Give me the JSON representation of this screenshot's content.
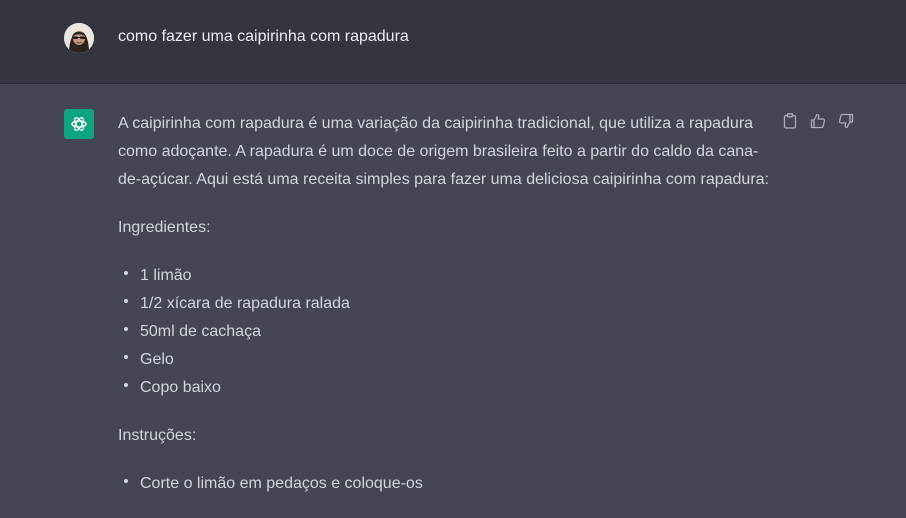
{
  "user_message": {
    "text": "como fazer uma caipirinha com rapadura",
    "avatar": "user-avatar-photo"
  },
  "assistant_message": {
    "intro": "A caipirinha com rapadura é uma variação da caipirinha tradicional, que utiliza a rapadura como adoçante. A rapadura é um doce de origem brasileira feito a partir do caldo da cana-de-açúcar. Aqui está uma receita simples para fazer uma deliciosa caipirinha com rapadura:",
    "ingredients_heading": "Ingredientes:",
    "ingredients": [
      "1 limão",
      "1/2 xícara de rapadura ralada",
      "50ml de cachaça",
      "Gelo",
      "Copo baixo"
    ],
    "instructions_heading": "Instruções:",
    "first_instruction_partial": "Corte o limão em pedaços e coloque-os"
  },
  "actions": {
    "copy": "clipboard-icon",
    "like": "thumbs-up-icon",
    "dislike": "thumbs-down-icon"
  },
  "colors": {
    "user_bg": "#343541",
    "assistant_bg": "#444654",
    "logo_bg": "#10a37f",
    "text": "#d1d5db"
  }
}
